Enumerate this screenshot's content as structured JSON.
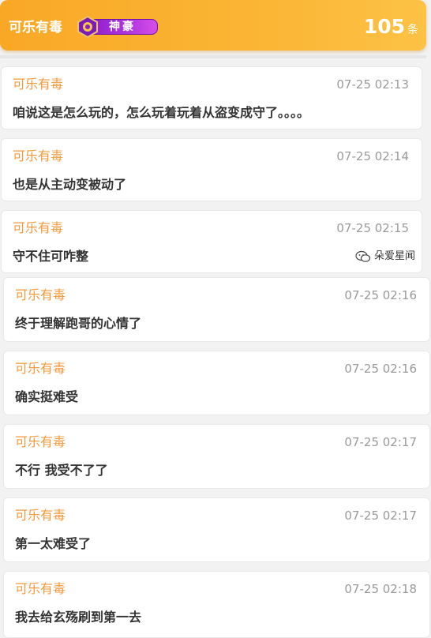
{
  "header": {
    "username": "可乐有毒",
    "badge_label": "神豪",
    "count": "105",
    "count_unit": "条"
  },
  "colors": {
    "header_gradient_start": "#f9a826",
    "header_gradient_end": "#fcc245",
    "username_color": "#f39a3d",
    "badge_purple": "#9a28d0"
  },
  "messages": [
    {
      "user": "可乐有毒",
      "time": "07-25 02:13",
      "text": "咱说这是怎么玩的，怎么玩着玩着从盗变成守了。。。。"
    },
    {
      "user": "可乐有毒",
      "time": "07-25 02:14",
      "text": "也是从主动变被动了"
    },
    {
      "user": "可乐有毒",
      "time": "07-25 02:15",
      "text": "守不住可咋整"
    },
    {
      "user": "可乐有毒",
      "time": "07-25 02:16",
      "text": "终于理解跑哥的心情了"
    },
    {
      "user": "可乐有毒",
      "time": "07-25 02:16",
      "text": "确实挺难受"
    },
    {
      "user": "可乐有毒",
      "time": "07-25 02:17",
      "text": "不行 我受不了了"
    },
    {
      "user": "可乐有毒",
      "time": "07-25 02:17",
      "text": "第一太难受了"
    },
    {
      "user": "可乐有毒",
      "time": "07-25 02:18",
      "text": "我去给玄殇刷到第一去"
    }
  ],
  "watermark": {
    "icon": "wechat-icon",
    "text": "朵爱星闻"
  }
}
